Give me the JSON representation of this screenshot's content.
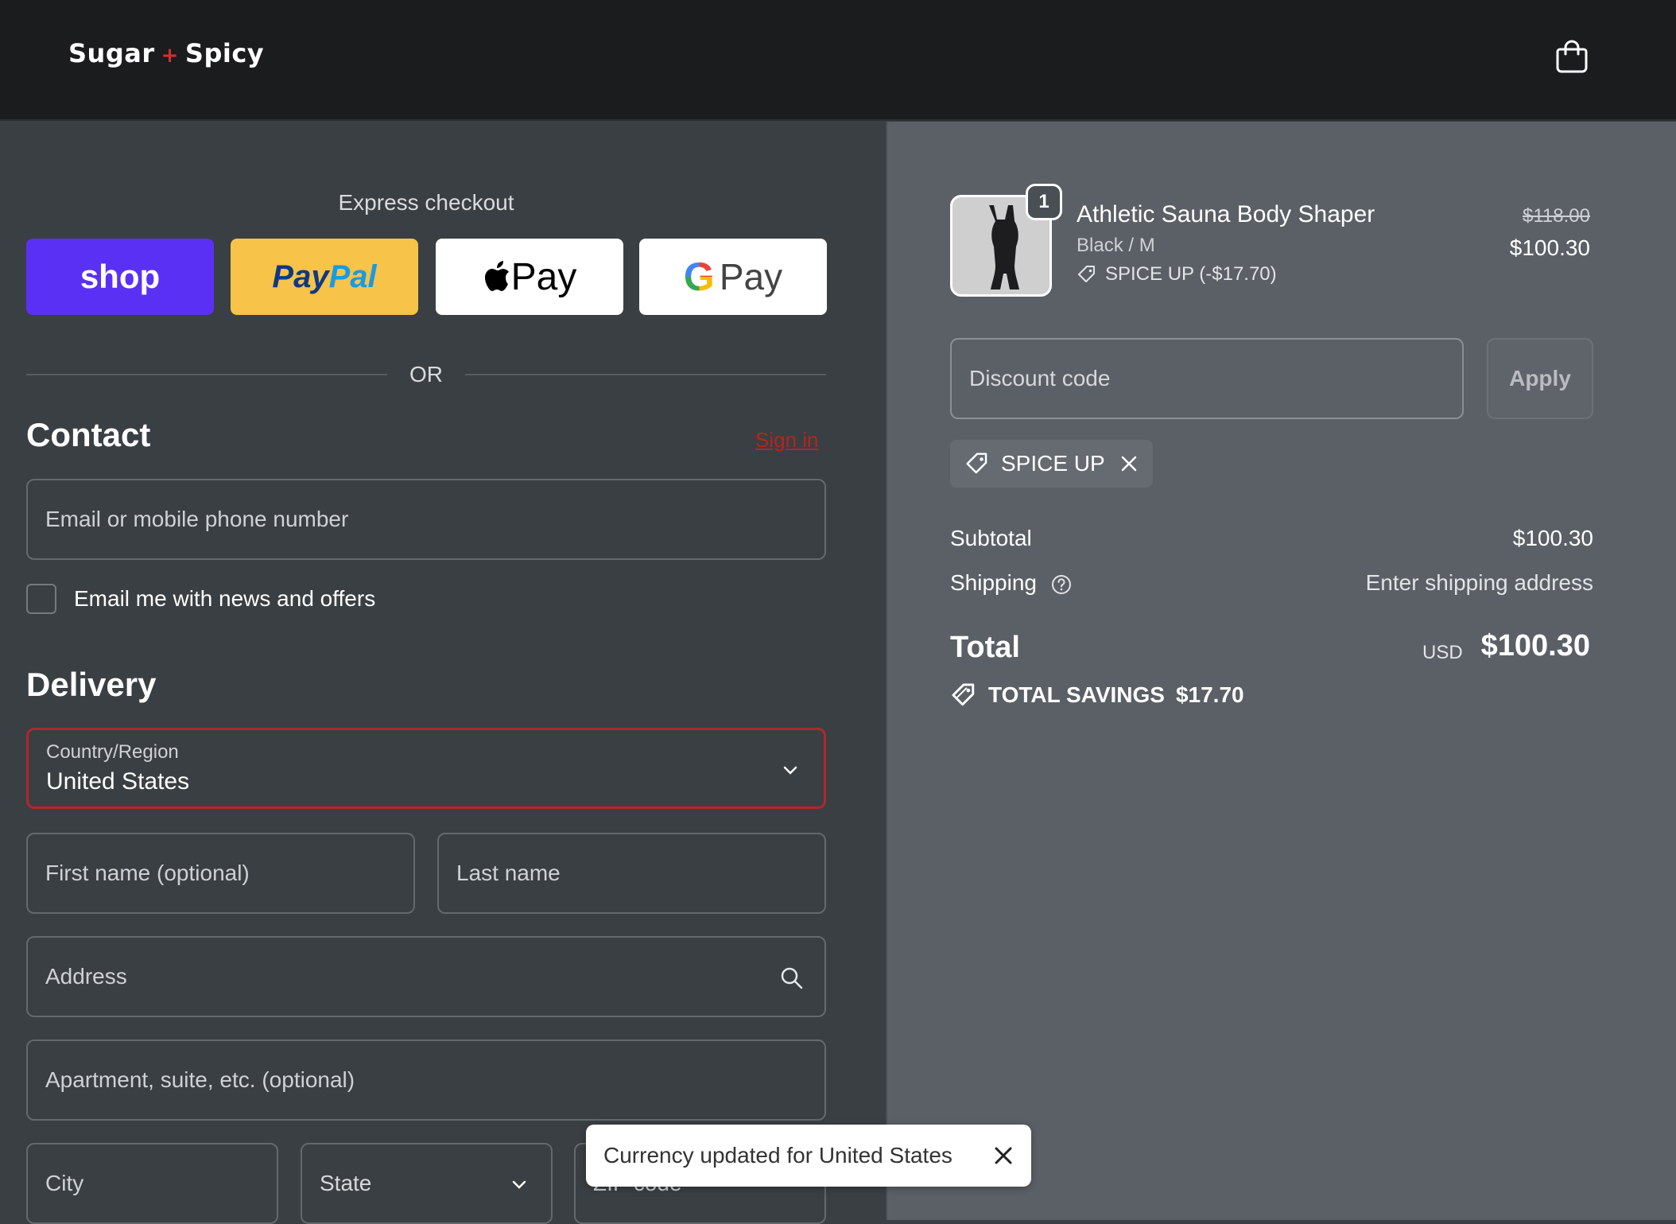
{
  "brand": {
    "name_left": "Sugar",
    "name_plus": "+",
    "name_right": "Spicy"
  },
  "express": {
    "title": "Express checkout",
    "shop_label": "shop",
    "paypal_pay": "Pay",
    "paypal_pal": "Pal",
    "apple_label": "Pay",
    "google_g": "G",
    "google_label": "Pay",
    "or_text": "OR"
  },
  "contact": {
    "title": "Contact",
    "signin": "Sign in",
    "email_placeholder": "Email or mobile phone number",
    "newsletter_label": "Email me with news and offers"
  },
  "delivery": {
    "title": "Delivery",
    "country_label": "Country/Region",
    "country_value": "United States",
    "first_name_placeholder": "First name (optional)",
    "last_name_placeholder": "Last name",
    "address_placeholder": "Address",
    "apartment_placeholder": "Apartment, suite, etc. (optional)",
    "city_placeholder": "City",
    "state_label": "State",
    "zip_placeholder": "ZIP code"
  },
  "toast": {
    "message": "Currency updated for United States"
  },
  "order": {
    "quantity": "1",
    "item_name": "Athletic Sauna Body Shaper",
    "item_variant": "Black / M",
    "item_discount": "SPICE UP (-$17.70)",
    "original_price": "$118.00",
    "price": "$100.30",
    "discount_placeholder": "Discount code",
    "apply_label": "Apply",
    "applied_code": "SPICE UP",
    "subtotal_label": "Subtotal",
    "subtotal_value": "$100.30",
    "shipping_label": "Shipping",
    "shipping_value": "Enter shipping address",
    "total_label": "Total",
    "total_currency": "USD",
    "total_value": "$100.30",
    "savings_label": "TOTAL SAVINGS",
    "savings_value": "$17.70"
  },
  "colors": {
    "header_bg": "#1b1c1e",
    "left_bg": "#3a3f43",
    "right_bg": "#5b6067",
    "shop_purple": "#5a31f4",
    "paypal_yellow": "#f7c348",
    "error_red": "#b0282a"
  }
}
